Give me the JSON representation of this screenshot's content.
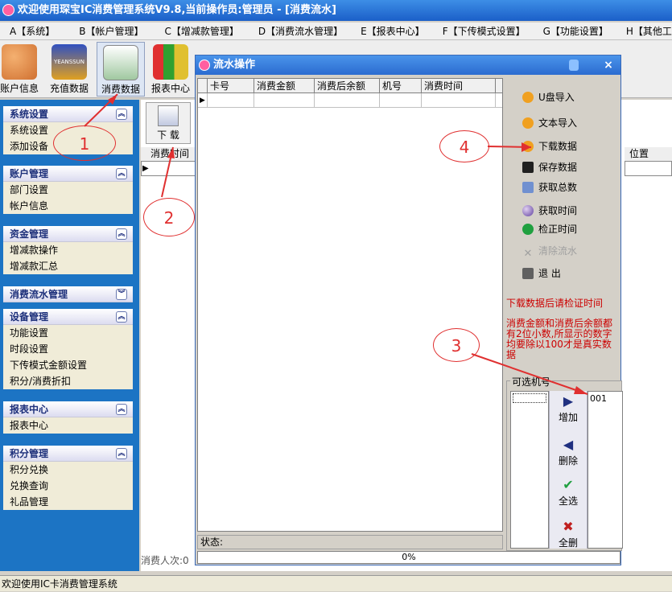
{
  "app": {
    "title": "欢迎使用琛宝IC消费管理系统V9.8,当前操作员:管理员 - [消费流水]"
  },
  "menu": [
    "A【系统】",
    "B【帐户管理】",
    "C【增减款管理】",
    "D【消费流水管理】",
    "E【报表中心】",
    "F【下传模式设置】",
    "G【功能设置】",
    "H【其他工具】"
  ],
  "toolbar": {
    "items": [
      "账户信息",
      "充值数据",
      "消费数据",
      "报表中心"
    ],
    "logo_text": "YEANSSUN"
  },
  "sidebar": {
    "groups": [
      {
        "title": "系统设置",
        "items": [
          "系统设置",
          "添加设备"
        ]
      },
      {
        "title": "账户管理",
        "items": [
          "部门设置",
          "帐户信息"
        ]
      },
      {
        "title": "资金管理",
        "items": [
          "增减款操作",
          "增减款汇总"
        ]
      },
      {
        "title": "消费流水管理",
        "items": []
      },
      {
        "title": "设备管理",
        "items": [
          "功能设置",
          "时段设置",
          "下传模式金额设置",
          "积分/消费折扣"
        ]
      },
      {
        "title": "报表中心",
        "items": [
          "报表中心"
        ]
      },
      {
        "title": "积分管理",
        "items": [
          "积分兑换",
          "兑换查询",
          "礼品管理"
        ]
      }
    ]
  },
  "main": {
    "download_label": "下 载",
    "grid_col": "消费时间",
    "pos_col": "位置",
    "count_label": "消费人次:0"
  },
  "dialog": {
    "title": "流水操作",
    "close": "×",
    "columns": [
      "卡号",
      "消费金额",
      "消费后余额",
      "机号",
      "消费时间"
    ],
    "actions": [
      "U盘导入",
      "文本导入",
      "下载数据",
      "保存数据",
      "获取总数",
      "获取时间",
      "检正时间",
      "清除流水",
      "退    出"
    ],
    "note1": "下载数据后请检证时间",
    "note2": "消费金额和消费后余额都有2位小数,所显示的数字均要除以100才是真实数据",
    "select_label": "可选机号",
    "machine": "001",
    "add": "增加",
    "del": "删除",
    "all": "全选",
    "clear": "全删",
    "status": "状态:",
    "progress": "0%"
  },
  "status": "欢迎使用IC卡消费管理系统",
  "annotations": [
    "1",
    "2",
    "3",
    "4"
  ]
}
